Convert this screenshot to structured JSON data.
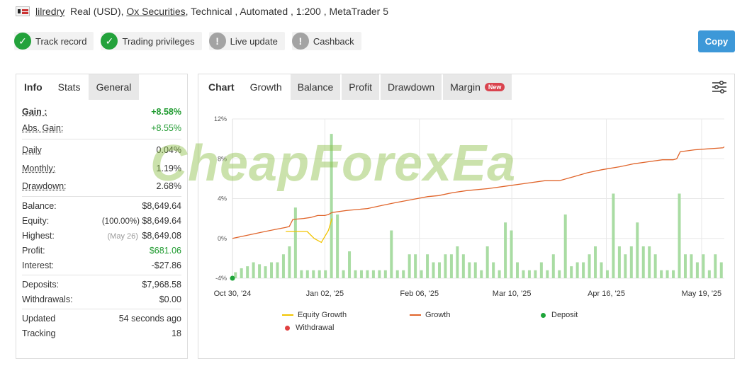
{
  "header": {
    "account_name": "lilredry",
    "account_type": "Real (USD),",
    "broker": "Ox Securities",
    "rest": ", Technical , Automated , 1:200 , MetaTrader 5"
  },
  "badges": [
    {
      "label": "Track record",
      "status": "ok"
    },
    {
      "label": "Trading privileges",
      "status": "ok"
    },
    {
      "label": "Live update",
      "status": "warn"
    },
    {
      "label": "Cashback",
      "status": "warn"
    }
  ],
  "copy_label": "Copy",
  "left_tabs": [
    "Info",
    "Stats",
    "General"
  ],
  "stats": {
    "gain": {
      "label": "Gain :",
      "value": "+8.58%"
    },
    "abs_gain": {
      "label": "Abs. Gain:",
      "value": "+8.55%"
    },
    "daily": {
      "label": "Daily",
      "value": "0.04%"
    },
    "monthly": {
      "label": "Monthly:",
      "value": "1.19%"
    },
    "drawdown": {
      "label": "Drawdown:",
      "value": "2.68%"
    },
    "balance": {
      "label": "Balance:",
      "value": "$8,649.64"
    },
    "equity": {
      "label": "Equity:",
      "pct": "(100.00%)",
      "value": "$8,649.64"
    },
    "highest": {
      "label": "Highest:",
      "date": "(May 26)",
      "value": "$8,649.08"
    },
    "profit": {
      "label": "Profit:",
      "value": "$681.06"
    },
    "interest": {
      "label": "Interest:",
      "value": "-$27.86"
    },
    "deposits": {
      "label": "Deposits:",
      "value": "$7,968.58"
    },
    "withdrawals": {
      "label": "Withdrawals:",
      "value": "$0.00"
    },
    "updated": {
      "label": "Updated",
      "value": "54 seconds ago"
    },
    "tracking": {
      "label": "Tracking",
      "value": "18"
    }
  },
  "chart_tabs": {
    "title": "Chart",
    "items": [
      "Growth",
      "Balance",
      "Profit",
      "Drawdown",
      "Margin"
    ],
    "new_badge": "New",
    "active": "Growth"
  },
  "watermark": "CheapForexEa",
  "colors": {
    "growth": "#e0642a",
    "equity": "#f2c400",
    "bars": "#a9dca3",
    "deposit": "#1ea53a",
    "withdrawal": "#e04040",
    "accent": "#3d98d8"
  },
  "chart_data": {
    "type": "line",
    "ylim": [
      -4,
      12
    ],
    "y_ticks": [
      "12%",
      "8%",
      "4%",
      "0%",
      "-4%"
    ],
    "x_ticks": [
      "Oct 30, '24",
      "Jan 02, '25",
      "Feb 06, '25",
      "Mar 10, '25",
      "Apr 16, '25",
      "May 19, '25"
    ],
    "legend": [
      "Equity Growth",
      "Growth",
      "Deposit",
      "Withdrawal"
    ],
    "growth": [
      [
        0,
        0.0
      ],
      [
        20,
        0.3
      ],
      [
        40,
        0.6
      ],
      [
        60,
        0.9
      ],
      [
        75,
        1.1
      ],
      [
        80,
        1.2
      ],
      [
        85,
        1.9
      ],
      [
        100,
        2.0
      ],
      [
        110,
        2.1
      ],
      [
        120,
        2.3
      ],
      [
        130,
        2.3
      ],
      [
        135,
        2.4
      ],
      [
        140,
        2.6
      ],
      [
        150,
        2.7
      ],
      [
        160,
        2.8
      ],
      [
        175,
        2.9
      ],
      [
        190,
        3.0
      ],
      [
        210,
        3.3
      ],
      [
        230,
        3.6
      ],
      [
        260,
        4.0
      ],
      [
        275,
        4.2
      ],
      [
        290,
        4.3
      ],
      [
        310,
        4.6
      ],
      [
        330,
        4.8
      ],
      [
        360,
        5.0
      ],
      [
        390,
        5.3
      ],
      [
        410,
        5.5
      ],
      [
        440,
        5.8
      ],
      [
        460,
        5.8
      ],
      [
        480,
        6.2
      ],
      [
        500,
        6.6
      ],
      [
        520,
        6.9
      ],
      [
        545,
        7.2
      ],
      [
        565,
        7.5
      ],
      [
        585,
        7.7
      ],
      [
        605,
        7.9
      ],
      [
        620,
        7.9
      ],
      [
        625,
        8.0
      ],
      [
        630,
        8.7
      ],
      [
        650,
        8.9
      ],
      [
        670,
        9.0
      ],
      [
        690,
        9.1
      ],
      [
        692,
        9.2
      ]
    ],
    "equity_growth": [
      [
        75,
        0.7
      ],
      [
        95,
        0.7
      ],
      [
        105,
        0.7
      ],
      [
        115,
        0.0
      ],
      [
        125,
        -0.4
      ],
      [
        135,
        0.8
      ],
      [
        140,
        2.0
      ]
    ],
    "bar_heights": [
      0.6,
      1.0,
      1.2,
      1.6,
      1.4,
      1.2,
      1.6,
      1.6,
      2.4,
      3.2,
      7.1,
      0.8,
      0.8,
      0.8,
      0.8,
      0.8,
      14.5,
      6.4,
      0.8,
      2.7,
      0.8,
      0.8,
      0.8,
      0.8,
      0.8,
      0.8,
      4.8,
      0.8,
      0.8,
      2.4,
      2.4,
      0.8,
      2.4,
      1.6,
      1.6,
      2.4,
      2.4,
      3.2,
      2.4,
      1.6,
      1.6,
      0.8,
      3.2,
      1.6,
      0.8,
      5.6,
      4.8,
      1.6,
      0.8,
      0.8,
      0.8,
      1.6,
      0.8,
      2.4,
      0.8,
      6.4,
      1.2,
      1.6,
      1.6,
      2.4,
      3.2,
      1.6,
      0.8,
      8.5,
      3.2,
      2.4,
      3.2,
      5.6,
      3.2,
      3.2,
      2.4,
      0.8,
      0.8,
      0.8,
      8.5,
      2.4,
      2.4,
      1.6,
      2.4,
      0.8,
      2.4,
      1.6
    ]
  }
}
